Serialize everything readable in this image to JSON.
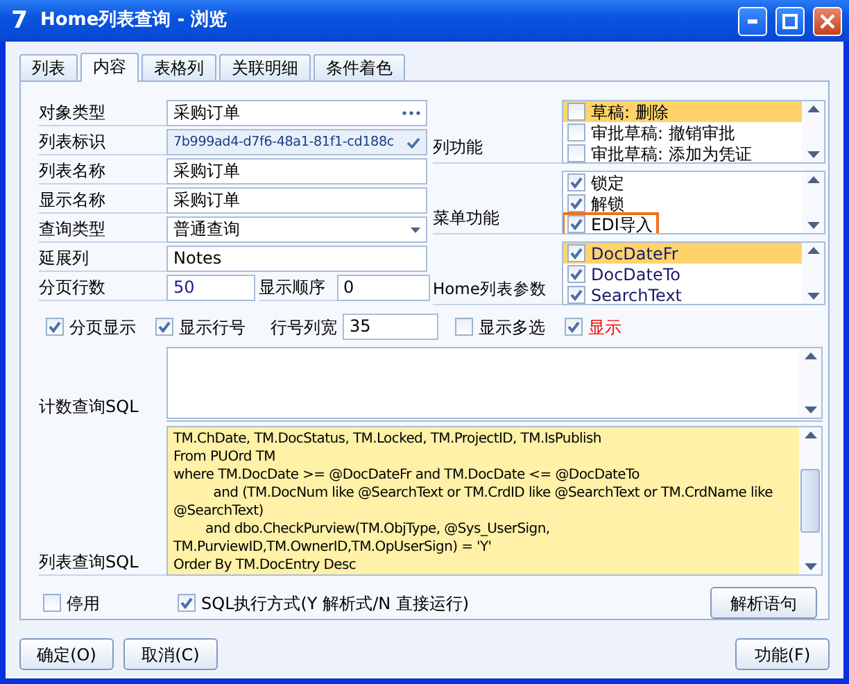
{
  "window": {
    "logo": "7",
    "title": "Home列表查询 - 浏览"
  },
  "tabs": [
    {
      "label": "列表",
      "selected": false
    },
    {
      "label": "内容",
      "selected": true
    },
    {
      "label": "表格列",
      "selected": false
    },
    {
      "label": "关联明细",
      "selected": false
    },
    {
      "label": "条件着色",
      "selected": false
    }
  ],
  "fields": [
    {
      "label": "对象类型",
      "value": "采购订单",
      "kind": "ellipsis"
    },
    {
      "label": "列表标识",
      "value": "7b999ad4-d7f6-48a1-81f1-cd188c",
      "kind": "check"
    },
    {
      "label": "列表名称",
      "value": "采购订单",
      "kind": "text"
    },
    {
      "label": "显示名称",
      "value": "采购订单",
      "kind": "text"
    },
    {
      "label": "查询类型",
      "value": "普通查询",
      "kind": "dropdown"
    },
    {
      "label": "延展列",
      "value": "Notes",
      "kind": "text"
    }
  ],
  "paging": {
    "label": "分页行数",
    "value": "50"
  },
  "order": {
    "label": "显示顺序",
    "value": "0"
  },
  "groups": [
    {
      "label": "列功能",
      "items": [
        {
          "label": "草稿: 删除",
          "checked": false,
          "selected": true,
          "focused": false
        },
        {
          "label": "审批草稿: 撤销审批",
          "checked": false,
          "selected": false,
          "focused": false
        },
        {
          "label": "审批草稿: 添加为凭证",
          "checked": false,
          "selected": false,
          "focused": false
        }
      ]
    },
    {
      "label": "菜单功能",
      "items": [
        {
          "label": "锁定",
          "checked": true,
          "selected": false,
          "focused": false
        },
        {
          "label": "解锁",
          "checked": true,
          "selected": false,
          "focused": false
        },
        {
          "label": "EDI导入",
          "checked": true,
          "selected": false,
          "focused": true
        }
      ]
    },
    {
      "label": "Home列表参数",
      "items": [
        {
          "label": "DocDateFr",
          "checked": true,
          "selected": true,
          "focused": false
        },
        {
          "label": "DocDateTo",
          "checked": true,
          "selected": false,
          "focused": false
        },
        {
          "label": "SearchText",
          "checked": true,
          "selected": false,
          "focused": false
        }
      ]
    }
  ],
  "options": [
    {
      "label": "分页显示",
      "checked": true
    },
    {
      "label": "显示行号",
      "checked": true
    }
  ],
  "row_width": {
    "label": "行号列宽",
    "value": "35"
  },
  "options2": [
    {
      "label": "显示多选",
      "checked": false,
      "color": "#000000"
    },
    {
      "label": "显示",
      "checked": true,
      "color": "#ff0000"
    }
  ],
  "count_sql": {
    "label": "计数查询SQL"
  },
  "list_sql": {
    "label": "列表查询SQL",
    "lines": [
      "TM.ChDate, TM.DocStatus, TM.Locked, TM.ProjectID, TM.IsPublish",
      "From PUOrd TM",
      "where TM.DocDate >= @DocDateFr and TM.DocDate <= @DocDateTo",
      "          and (TM.DocNum like @SearchText or TM.CrdID like @SearchText or TM.CrdName like",
      "@SearchText)",
      "        and dbo.CheckPurview(TM.ObjType, @Sys_UserSign,",
      "TM.PurviewID,TM.OwnerID,TM.OpUserSign) = 'Y'",
      "Order By TM.DocEntry Desc"
    ]
  },
  "disabled_option": {
    "label": "停用",
    "checked": false
  },
  "sql_mode": {
    "label": "SQL执行方式(Y 解析式/N 直接运行)",
    "checked": true
  },
  "parse_button": "解析语句",
  "footer_buttons": [
    {
      "label": "确定(O)",
      "kind": "left"
    },
    {
      "label": "取消(C)",
      "kind": "left"
    },
    {
      "label": "功能(F)",
      "kind": "right"
    }
  ]
}
